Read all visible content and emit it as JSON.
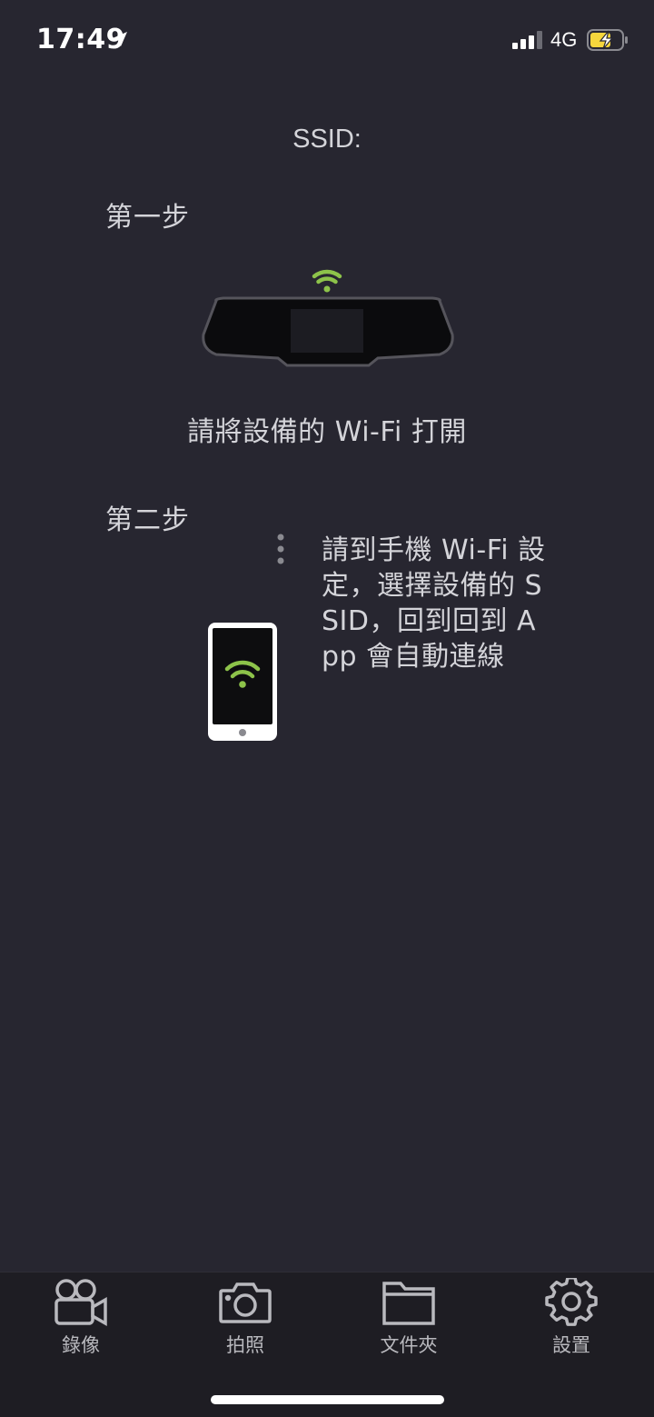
{
  "status_bar": {
    "time": "17:49",
    "network": "4G",
    "icons": [
      "location-arrow-icon",
      "cellular-signal-icon",
      "battery-charging-icon"
    ],
    "battery_color": "#f5d63d"
  },
  "main": {
    "ssid_label": "SSID:",
    "step1": {
      "title": "第一步",
      "illustration": "rearview-mirror-dashcam-wifi",
      "instruction": "請將設備的 Wi-Fi 打開"
    },
    "step2": {
      "title": "第二步",
      "illustration": "phone-wifi",
      "instruction": "請到手機 Wi-Fi 設定，選擇設備的 SSID，回到回到 App 會自動連線"
    },
    "accent_color": "#8dc34a"
  },
  "tab_bar": {
    "items": [
      {
        "label": "錄像",
        "icon": "video-camera-icon"
      },
      {
        "label": "拍照",
        "icon": "camera-icon"
      },
      {
        "label": "文件夾",
        "icon": "folder-icon"
      },
      {
        "label": "設置",
        "icon": "gear-icon"
      }
    ]
  }
}
